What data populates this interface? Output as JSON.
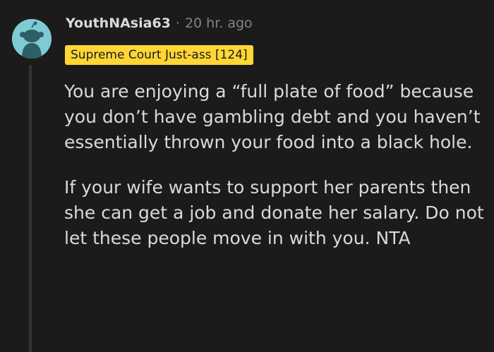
{
  "comment": {
    "username": "YouthNAsia63",
    "separator": "·",
    "timestamp": "20 hr. ago",
    "flair": "Supreme Court Just-ass [124]",
    "avatar_icon": "snoo-avatar-icon",
    "paragraphs": [
      "You are enjoying a “full plate of food” because you don’t have gambling debt and you haven’t essentially thrown your food into a black hole.",
      "If your wife wants to support her parents then she can get a job and donate her salary. Do not let these people move in with you. NTA"
    ]
  },
  "colors": {
    "background": "#1b1b1c",
    "avatar_bg": "#7fcbd3",
    "flair_bg": "#ffd635",
    "text": "#d7dadc",
    "meta": "#818384"
  }
}
